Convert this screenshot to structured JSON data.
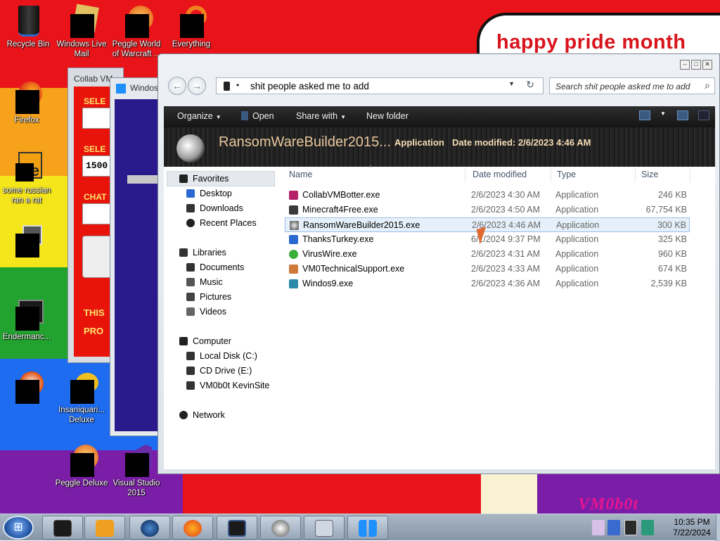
{
  "desktop": {
    "icons": [
      {
        "label": "Recycle Bin",
        "line2": ""
      },
      {
        "label": "Windows Live",
        "line2": "Mail"
      },
      {
        "label": "Peggle World",
        "line2": "of Warcraft ..."
      },
      {
        "label": "Everything",
        "line2": ""
      },
      {
        "label": "Firefox",
        "line2": ""
      },
      {
        "label": "some russian",
        "line2": "ran a rat"
      },
      {
        "label": "",
        "line2": ""
      },
      {
        "label": "Endermanc...",
        "line2": ""
      },
      {
        "label": "",
        "line2": ""
      },
      {
        "label": "Insaniquari...",
        "line2": "Deluxe"
      },
      {
        "label": "Peggle Deluxe",
        "line2": ""
      },
      {
        "label": "Visual Studio",
        "line2": "2015"
      }
    ],
    "wallpaper_sign": "happy pride month",
    "wallpaper_logo": "VM0b0t",
    "wallpaper_colors": [
      "#e8141a",
      "#f7a21b",
      "#f4e61a",
      "#22a22f",
      "#1e6cf0",
      "#7a1ea8"
    ]
  },
  "collab_window": {
    "title": "Collab VM",
    "labels": [
      "SELE",
      "SELE",
      "CHAT",
      "THIS",
      "PRO"
    ],
    "field_values": [
      "",
      "1500",
      ""
    ]
  },
  "win10_window": {
    "title": "Windos",
    "heading": "",
    "body1": "",
    "footer1": "",
    "footer2": "",
    "footer3": ""
  },
  "explorer": {
    "address": "shit people asked me to add",
    "search_placeholder": "Search shit people asked me to add",
    "toolbar": {
      "organize": "Organize",
      "open": "Open",
      "share_with": "Share with",
      "new_folder": "New folder"
    },
    "details": {
      "name": "RansomWareBuilder2015...",
      "type": "Application",
      "modified": "Date modified: 2/6/2023 4:46 AM"
    },
    "nav": {
      "favorites": "Favorites",
      "desktop": "Desktop",
      "downloads": "Downloads",
      "recent": "Recent Places",
      "libraries": "Libraries",
      "documents": "Documents",
      "music": "Music",
      "pictures": "Pictures",
      "videos": "Videos",
      "computer": "Computer",
      "local_disk": "Local Disk (C:)",
      "cd_drive": "CD Drive (E:)",
      "vm_site": "VM0b0t KevinSite",
      "network": "Network"
    },
    "columns": {
      "name": "Name",
      "date": "Date modified",
      "type": "Type",
      "size": "Size"
    },
    "files": [
      {
        "name": "CollabVMBotter.exe",
        "date": "2/6/2023 4:30 AM",
        "type": "Application",
        "size": "246 KB",
        "icon_color": "#b5226b"
      },
      {
        "name": "Minecraft4Free.exe",
        "date": "2/6/2023 4:50 AM",
        "type": "Application",
        "size": "67,754 KB",
        "icon_color": "#3a3a3a"
      },
      {
        "name": "RansomWareBuilder2015.exe",
        "date": "2/6/2023 4:46 AM",
        "type": "Application",
        "size": "300 KB",
        "icon_color": "#444444"
      },
      {
        "name": "ThanksTurkey.exe",
        "date": "6/1/2024 9:37 PM",
        "type": "Application",
        "size": "325 KB",
        "icon_color": "#2a6ad0"
      },
      {
        "name": "VirusWire.exe",
        "date": "2/6/2023 4:31 AM",
        "type": "Application",
        "size": "960 KB",
        "icon_color": "#3ab03a"
      },
      {
        "name": "VM0TechnicalSupport.exe",
        "date": "2/6/2023 4:33 AM",
        "type": "Application",
        "size": "674 KB",
        "icon_color": "#d07a3a"
      },
      {
        "name": "Windos9.exe",
        "date": "2/6/2023 4:36 AM",
        "type": "Application",
        "size": "2,539 KB",
        "icon_color": "#2a8aa8"
      }
    ],
    "selected_index": 2
  },
  "taskbar": {
    "time": "10:35 PM",
    "date": "7/22/2024",
    "pinned": [
      "terminal",
      "media-player",
      "globe",
      "firefox",
      "monitor",
      "disc",
      "keyboard",
      "windows-logo"
    ]
  }
}
